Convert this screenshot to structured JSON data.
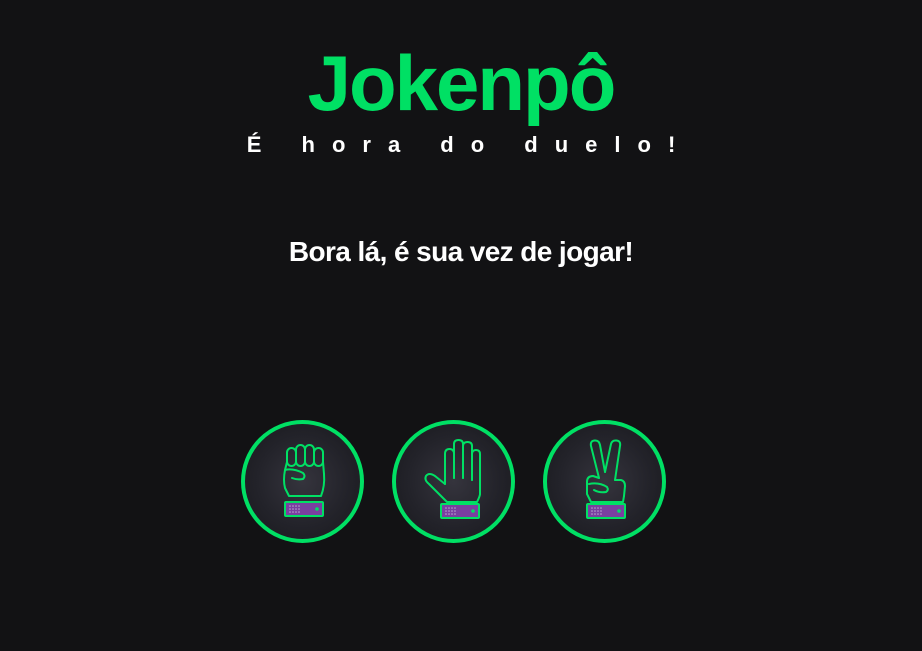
{
  "header": {
    "title": "Jokenpô",
    "subtitle": "É hora do duelo!"
  },
  "prompt": "Bora lá, é sua vez de jogar!",
  "choices": [
    {
      "icon": "rock-hand-icon"
    },
    {
      "icon": "paper-hand-icon"
    },
    {
      "icon": "scissors-hand-icon"
    }
  ],
  "colors": {
    "accent": "#00e064",
    "background": "#121214",
    "cuff": "#7a3fa0"
  }
}
